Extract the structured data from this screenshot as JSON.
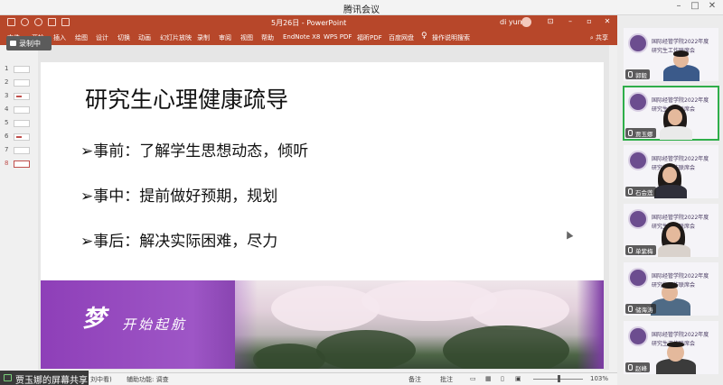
{
  "meeting": {
    "title": "腾讯会议"
  },
  "ppt": {
    "doc_title": "5月26日 - PowerPoint",
    "user_name": "di yuna",
    "tabs": [
      "文件",
      "开始",
      "插入",
      "绘图",
      "设计",
      "切换",
      "动画",
      "幻灯片放映",
      "录制",
      "审阅",
      "视图",
      "帮助",
      "EndNote X8",
      "WPS PDF",
      "福昕PDF",
      "百度网盘",
      "操作说明搜索"
    ],
    "share_label": "共享",
    "recording_label": "录制中",
    "slide_numbers": [
      "1",
      "2",
      "3",
      "4",
      "5",
      "6",
      "7",
      "8"
    ],
    "status": {
      "slide_info": "刘中看)",
      "accessibility": "辅助功能: 调查",
      "notes": "备注",
      "comments": "批注",
      "zoom": "103%"
    }
  },
  "slide": {
    "title": "研究生心理健康疏导",
    "bullets": [
      "➢事前：了解学生思想动态，倾听",
      "➢事中：提前做好预期，规划",
      "➢事后：解决实际困难，尽力"
    ],
    "banner_char": "梦",
    "banner_text": "开始起航"
  },
  "share_banner": "贾玉娜的屏幕共享",
  "participants": {
    "emblem_line1": "国际经管学院2022年度",
    "emblem_line2": "研究生工作联席会",
    "people": [
      {
        "name": "郭毅",
        "speaking": false
      },
      {
        "name": "贾玉娜",
        "speaking": true
      },
      {
        "name": "石会莲",
        "speaking": false
      },
      {
        "name": "单紫梅",
        "speaking": false
      },
      {
        "name": "储海涛",
        "speaking": false
      },
      {
        "name": "赵峰",
        "speaking": false
      }
    ]
  },
  "colors": {
    "ppt_accent": "#b7472a",
    "banner_purple": "#7d3ba5",
    "speaking_border": "#2fae4a"
  }
}
